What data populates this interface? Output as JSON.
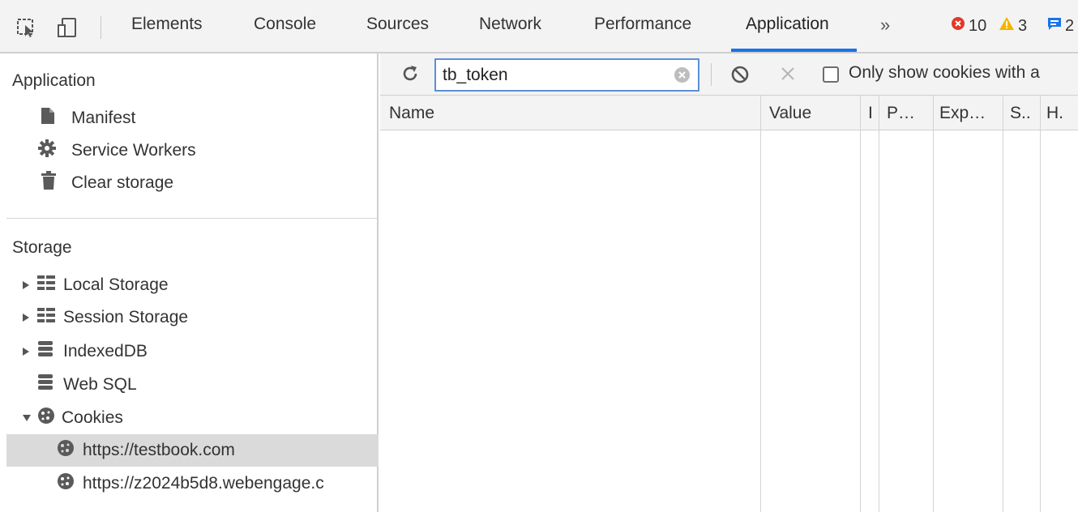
{
  "tabs": [
    {
      "label": "Elements"
    },
    {
      "label": "Console"
    },
    {
      "label": "Sources"
    },
    {
      "label": "Network"
    },
    {
      "label": "Performance"
    },
    {
      "label": "Application"
    }
  ],
  "more_label": "»",
  "counts": {
    "errors": "10",
    "warnings": "3",
    "messages": "2"
  },
  "colors": {
    "accent": "#1a73e8",
    "error": "#e0392b",
    "warning": "#f4b400",
    "info": "#1a73e8"
  },
  "sidebar": {
    "application_title": "Application",
    "app_items": [
      {
        "label": "Manifest",
        "icon": "file-icon"
      },
      {
        "label": "Service Workers",
        "icon": "gear-icon"
      },
      {
        "label": "Clear storage",
        "icon": "trash-icon"
      }
    ],
    "storage_title": "Storage",
    "storage_items": [
      {
        "label": "Local Storage",
        "icon": "table-icon"
      },
      {
        "label": "Session Storage",
        "icon": "table-icon"
      },
      {
        "label": "IndexedDB",
        "icon": "database-icon"
      },
      {
        "label": "Web SQL",
        "icon": "database-icon"
      },
      {
        "label": "Cookies",
        "icon": "cookie-icon"
      }
    ],
    "cookie_items": [
      {
        "label": "https://testbook.com"
      },
      {
        "label": "https://z2024b5d8.webengage.c"
      }
    ]
  },
  "toolbar": {
    "filter_value": "tb_token",
    "only_show_label": "Only show cookies with a"
  },
  "table": {
    "columns": [
      "Name",
      "Value",
      "I",
      "P…",
      "Exp…",
      "S..",
      "H."
    ]
  }
}
